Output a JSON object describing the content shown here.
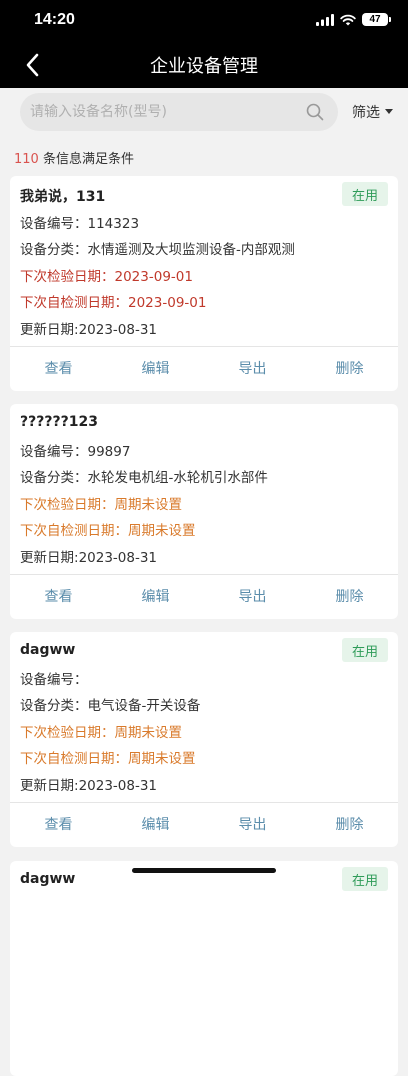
{
  "status_bar": {
    "time": "14:20",
    "battery": "47"
  },
  "header": {
    "title": "企业设备管理"
  },
  "search": {
    "placeholder": "请输入设备名称(型号)",
    "value": "",
    "filter_label": "筛选"
  },
  "result": {
    "count": "110",
    "suffix": "条信息满足条件"
  },
  "labels": {
    "code": "设备编号：",
    "category": "设备分类：",
    "next_inspection": "下次检验日期：",
    "next_self_check": "下次自检测日期：",
    "updated": "更新日期:"
  },
  "actions": {
    "view": "查看",
    "edit": "编辑",
    "export": "导出",
    "delete": "删除"
  },
  "devices": [
    {
      "name": "我弟说，131",
      "status": "在用",
      "code": "114323",
      "category": "水情遥测及大坝监测设备-内部观测",
      "next_inspection": "2023-09-01",
      "next_self_check": "2023-09-01",
      "updated": "2023-08-31"
    },
    {
      "name": "??????123",
      "status": "",
      "code": "99897",
      "category": "水轮发电机组-水轮机引水部件",
      "next_inspection": "周期未设置",
      "next_self_check": "周期未设置",
      "updated": "2023-08-31"
    },
    {
      "name": "dagww",
      "status": "在用",
      "code": "",
      "category": "电气设备-开关设备",
      "next_inspection": "周期未设置",
      "next_self_check": "周期未设置",
      "updated": "2023-08-31"
    },
    {
      "name": "dagww",
      "status": "在用"
    }
  ],
  "colors": {
    "accent_red": "#d9534f",
    "date_red": "#c0392b",
    "unset_orange": "#d97a2b",
    "badge_green": "#2e9b58",
    "action_blue": "#5b8dab"
  }
}
